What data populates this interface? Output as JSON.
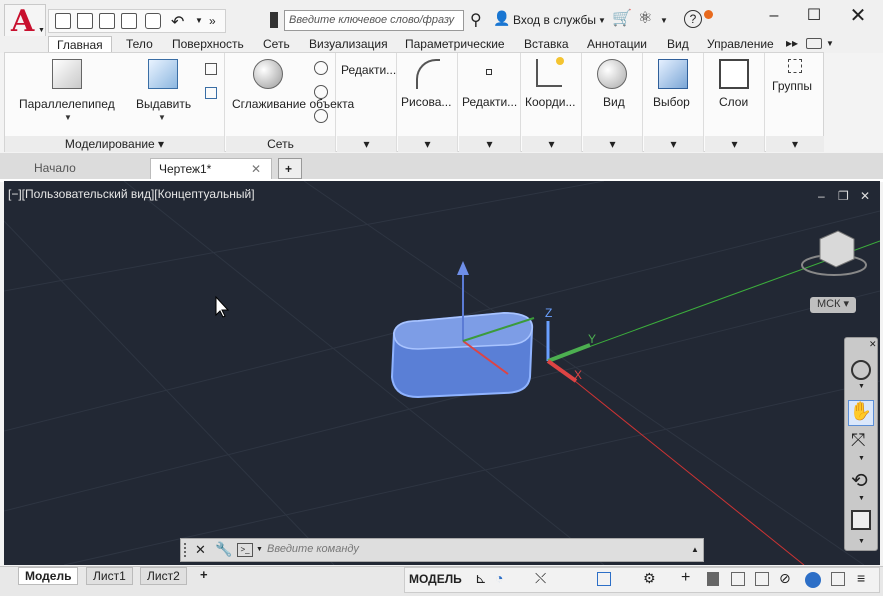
{
  "app": {
    "logo": "A",
    "sub": "M"
  },
  "search": {
    "placeholder": "Введите ключевое слово/фразу"
  },
  "signin": "Вход в службы",
  "help": "?",
  "ribbon_tabs": [
    "Главная",
    "Тело",
    "Поверхность",
    "Сеть",
    "Визуализация",
    "Параметрические",
    "Вставка",
    "Аннотации",
    "Вид",
    "Управление"
  ],
  "ribbon": {
    "box": "Параллелепипед",
    "extrude": "Выдавить",
    "modeling": "Моделирование",
    "smooth": "Сглаживание объекта",
    "mesh": "Сеть",
    "edit1": "Редакти...",
    "draw": "Рисова...",
    "edit2": "Редакти...",
    "coords": "Коорди...",
    "view": "Вид",
    "select": "Выбор",
    "layers": "Слои",
    "groups": "Группы"
  },
  "doctabs": {
    "start": "Начало",
    "drawing": "Чертеж1*",
    "add": "+"
  },
  "viewport": {
    "label": "[−][Пользовательский вид][Концептуальный]",
    "wcs": "МСК"
  },
  "cmd": {
    "placeholder": "Введите команду"
  },
  "status": {
    "model": "Модель",
    "sheet1": "Лист1",
    "sheet2": "Лист2",
    "add": "+",
    "space": "МОДЕЛЬ"
  }
}
